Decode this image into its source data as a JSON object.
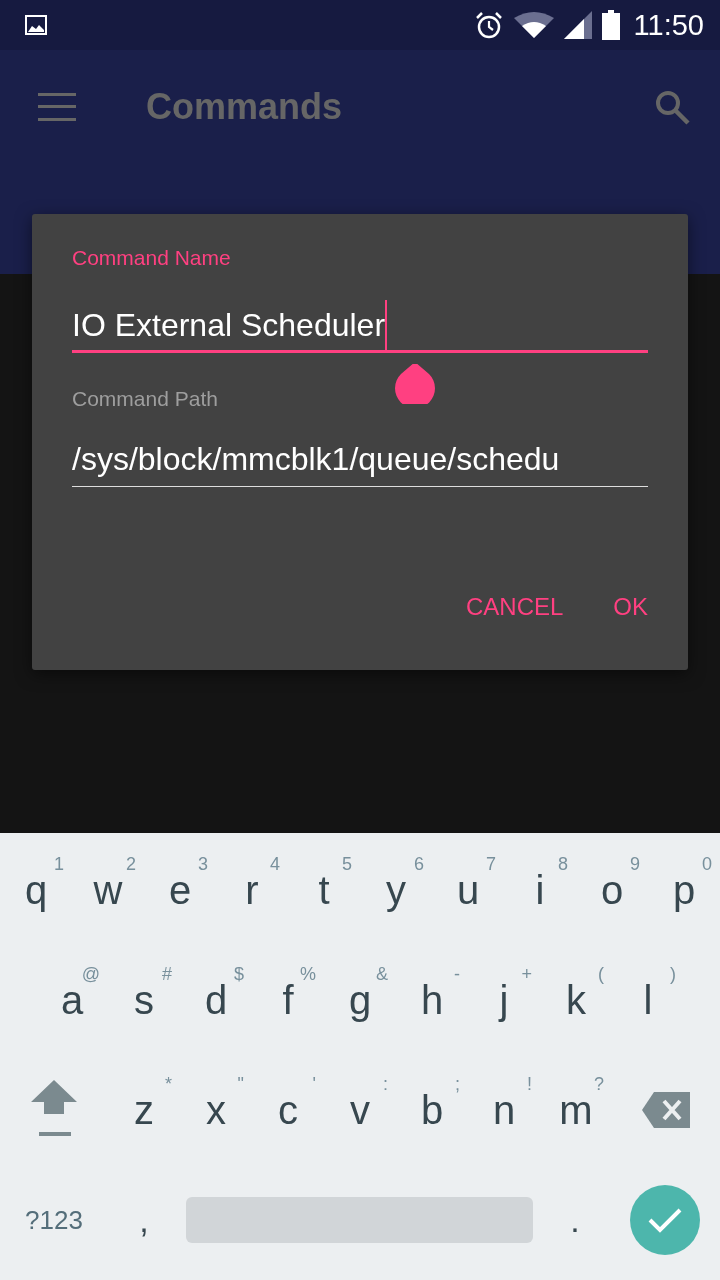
{
  "status_bar": {
    "time": "11:50"
  },
  "app_bar": {
    "title": "Commands"
  },
  "dialog": {
    "fields": [
      {
        "label": "Command Name",
        "value": "IO External Scheduler",
        "focused": true
      },
      {
        "label": "Command Path",
        "value": "/sys/block/mmcblk1/queue/schedu",
        "focused": false
      }
    ],
    "buttons": [
      "CANCEL",
      "OK"
    ]
  },
  "keyboard": {
    "rows": [
      [
        {
          "key": "q",
          "hint": "1"
        },
        {
          "key": "w",
          "hint": "2"
        },
        {
          "key": "e",
          "hint": "3"
        },
        {
          "key": "r",
          "hint": "4"
        },
        {
          "key": "t",
          "hint": "5"
        },
        {
          "key": "y",
          "hint": "6"
        },
        {
          "key": "u",
          "hint": "7"
        },
        {
          "key": "i",
          "hint": "8"
        },
        {
          "key": "o",
          "hint": "9"
        },
        {
          "key": "p",
          "hint": "0"
        }
      ],
      [
        {
          "key": "a",
          "hint": "@"
        },
        {
          "key": "s",
          "hint": "#"
        },
        {
          "key": "d",
          "hint": "$"
        },
        {
          "key": "f",
          "hint": "%"
        },
        {
          "key": "g",
          "hint": "&"
        },
        {
          "key": "h",
          "hint": "-"
        },
        {
          "key": "j",
          "hint": "+"
        },
        {
          "key": "k",
          "hint": "("
        },
        {
          "key": "l",
          "hint": ")"
        }
      ],
      [
        {
          "key": "z",
          "hint": "*"
        },
        {
          "key": "x",
          "hint": "\""
        },
        {
          "key": "c",
          "hint": "'"
        },
        {
          "key": "v",
          "hint": ":"
        },
        {
          "key": "b",
          "hint": ";"
        },
        {
          "key": "n",
          "hint": "!"
        },
        {
          "key": "m",
          "hint": "?"
        }
      ]
    ],
    "symbols_key": "?123",
    "comma_key": ",",
    "period_key": "."
  }
}
